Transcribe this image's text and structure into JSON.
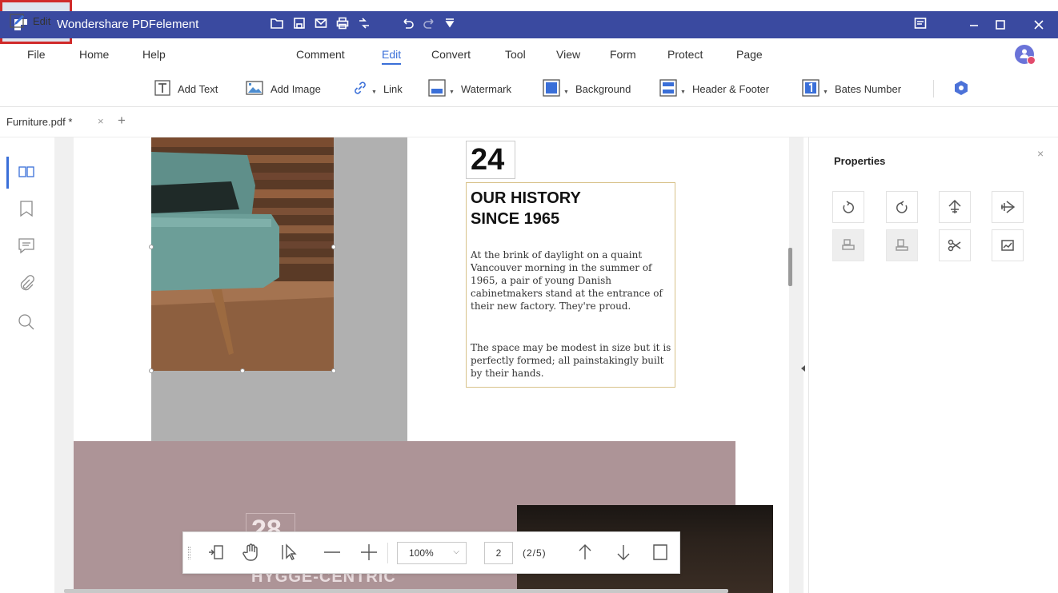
{
  "app": {
    "title": "Wondershare PDFelement",
    "window_controls": [
      "minimize-icon",
      "maximize-icon",
      "close-icon"
    ]
  },
  "menu": {
    "file": "File",
    "items": [
      "Home",
      "Help",
      "Comment",
      "Edit",
      "Convert",
      "Tool",
      "View",
      "Form",
      "Protect",
      "Page"
    ],
    "active": "Edit"
  },
  "toolbar": {
    "edit": "Edit",
    "add_text": "Add Text",
    "add_image": "Add Image",
    "link": "Link",
    "watermark": "Watermark",
    "background": "Background",
    "header_footer": "Header & Footer",
    "bates_number": "Bates Number"
  },
  "tab": {
    "filename": "Furniture.pdf *",
    "close": "×",
    "add": "+"
  },
  "document": {
    "page_number_big": "24",
    "history_title_line1": "OUR HISTORY",
    "history_title_line2": "SINCE 1965",
    "paragraph1": "At the brink of daylight on a quaint Vancouver morning in the summer of 1965, a pair of young Danish cabinetmakers stand at the entrance of their new factory. They're proud.",
    "paragraph2": "The space may be modest in size but it is perfectly formed; all painstakingly built by their hands.",
    "number_28": "28",
    "hygge": "HYGGE-CENTRIC"
  },
  "bottom_toolbar": {
    "zoom": "100%",
    "page_input": "2",
    "page_count": "(2/5)"
  },
  "properties": {
    "title": "Properties",
    "close": "×"
  },
  "colors": {
    "titlebar": "#3a4aa0",
    "accent": "#3a6fd8",
    "highlight_border": "#d02a2a",
    "pink_block": "#ad9497",
    "gray_block": "#b0b0b0"
  }
}
